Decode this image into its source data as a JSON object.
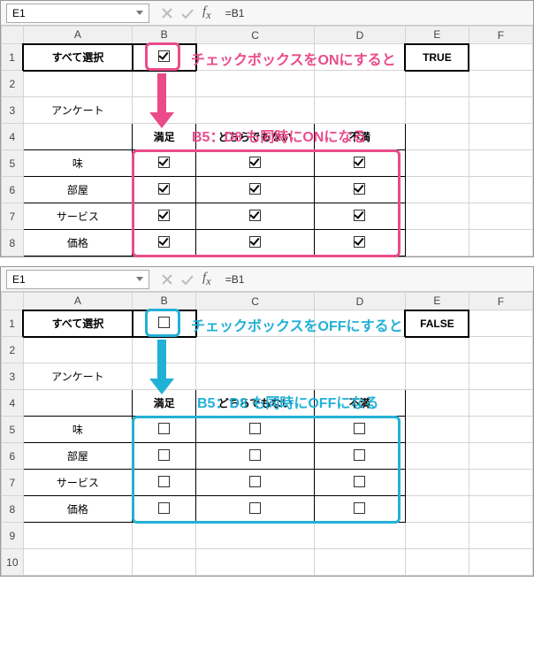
{
  "top": {
    "nameBox": "E1",
    "formula": "=B1",
    "cols": [
      "A",
      "B",
      "C",
      "D",
      "E",
      "F"
    ],
    "rows": [
      "1",
      "2",
      "3",
      "4",
      "5",
      "6",
      "7",
      "8"
    ],
    "a1": "すべて選択",
    "e1": "TRUE",
    "a3": "アンケート",
    "b4": "満足",
    "c4": "どちらでもない",
    "d4": "不満",
    "a5": "味",
    "a6": "部屋",
    "a7": "サービス",
    "a8": "価格",
    "annot1": "チェックボックスをONにすると",
    "annot2": "B5：D8 も同時にONになる"
  },
  "bottom": {
    "nameBox": "E1",
    "formula": "=B1",
    "cols": [
      "A",
      "B",
      "C",
      "D",
      "E",
      "F"
    ],
    "rows": [
      "1",
      "2",
      "3",
      "4",
      "5",
      "6",
      "7",
      "8",
      "9",
      "10"
    ],
    "a1": "すべて選択",
    "e1": "FALSE",
    "a3": "アンケート",
    "b4": "満足",
    "c4": "どちらでもない",
    "d4": "不満",
    "a5": "味",
    "a6": "部屋",
    "a7": "サービス",
    "a8": "価格",
    "annot1": "チェックボックスをOFFにすると",
    "annot2": "B5：D8 も同時にOFFになる"
  }
}
